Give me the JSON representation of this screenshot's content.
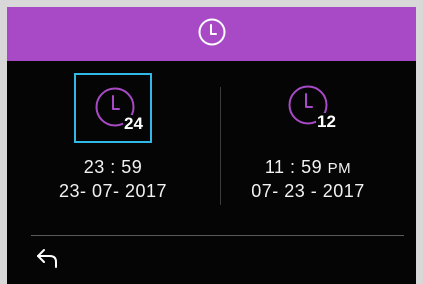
{
  "header": {
    "icon": "clock-icon",
    "accent_color": "#a84ac6"
  },
  "formats": [
    {
      "id": "24h",
      "label": "24",
      "time": "23 : 59",
      "ampm": "",
      "date": "23- 07- 2017",
      "selected": true
    },
    {
      "id": "12h",
      "label": "12",
      "time": "11 : 59",
      "ampm": "PM",
      "date": "07- 23 - 2017",
      "selected": false
    }
  ],
  "footer": {
    "back_icon": "back-arrow-icon"
  },
  "colors": {
    "selection": "#30b8e6",
    "clock_stroke": "#a84ac6",
    "background": "#050505"
  }
}
